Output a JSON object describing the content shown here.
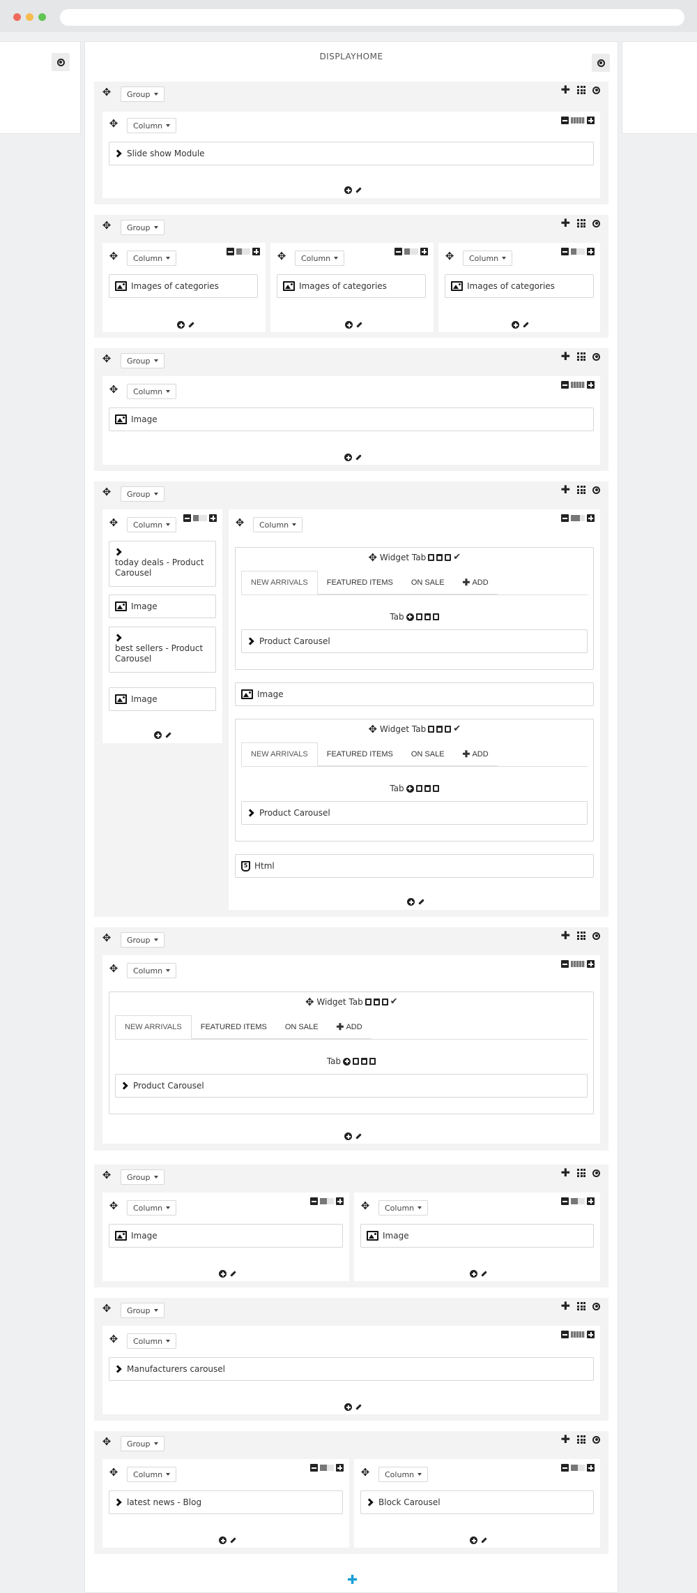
{
  "hook": {
    "title": "DISPLAYHOME"
  },
  "labels": {
    "group": "Group",
    "column": "Column",
    "widget_tab": "Widget Tab",
    "tab": "Tab",
    "html5_glyph": "5"
  },
  "tabs": [
    "NEW ARRIVALS",
    "FEATURED ITEMS",
    "ON SALE",
    "ADD"
  ],
  "modules": {
    "slideshow": "Slide show Module",
    "images_of_categories": "Images of categories",
    "image": "Image",
    "today_deals": "today deals - Product Carousel",
    "best_sellers": "best sellers - Product Carousel",
    "product_carousel": "Product Carousel",
    "html": "Html",
    "manufacturers": "Manufacturers carousel",
    "latest_news": "latest news - Blog",
    "block_carousel": "Block Carousel"
  },
  "colors": {
    "accent": "#1a9fd6",
    "window_red": "#ef6a5e",
    "window_yellow": "#f5bd4f",
    "window_green": "#61c554"
  }
}
